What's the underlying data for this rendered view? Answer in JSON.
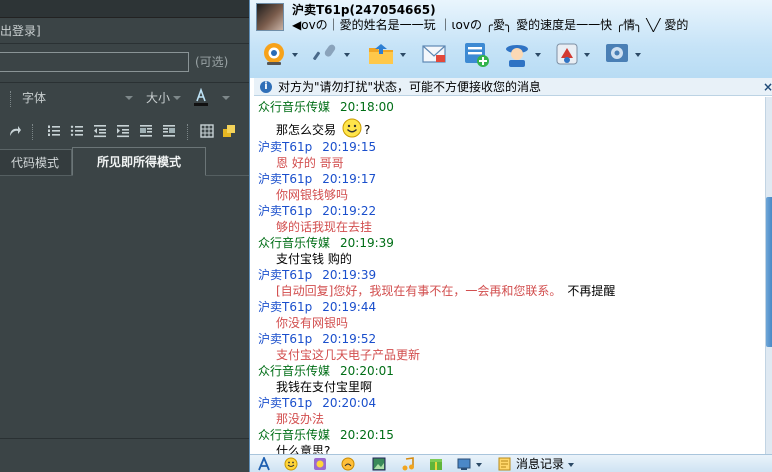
{
  "editor": {
    "logout_text": "出登录]",
    "optional_label": "(可选)",
    "toolbar": {
      "font_label": "字体",
      "size_label": "大小"
    },
    "tabs": [
      {
        "label": "代码模式"
      },
      {
        "label": "所见即所得模式"
      }
    ]
  },
  "chat": {
    "contact_name": "沪卖T61p(247054665)",
    "signature": "◀ovの｜愛的姓名是一一玩  ｜ιovの  ╭愛╮  愛的速度是一一快  ╭情╮  ╲╱  愛的",
    "notice": "对方为\"请勿打扰\"状态，可能不方便接收您的消息",
    "notice_close": "×",
    "messages": [
      {
        "sender": "众行音乐传媒",
        "time": "20:18:00",
        "text": "那怎么交易",
        "role": "self"
      },
      {
        "sender": "沪卖T61p",
        "time": "20:19:15",
        "text": "恩 好的 哥哥",
        "role": "peer"
      },
      {
        "sender": "沪卖T61p",
        "time": "20:19:17",
        "text": "你网银钱够吗",
        "role": "peer"
      },
      {
        "sender": "沪卖T61p",
        "time": "20:19:22",
        "text": "够的话我现在去挂",
        "role": "peer"
      },
      {
        "sender": "众行音乐传媒",
        "time": "20:19:39",
        "text": "支付宝钱  购的",
        "role": "self"
      },
      {
        "sender": "沪卖T61p",
        "time": "20:19:39",
        "text": "[自动回复]您好，我现在有事不在，一会再和您联系。",
        "extra": "不再提醒",
        "role": "peer"
      },
      {
        "sender": "沪卖T61p",
        "time": "20:19:44",
        "text": "你没有网银吗",
        "role": "peer"
      },
      {
        "sender": "沪卖T61p",
        "time": "20:19:52",
        "text": "支付宝这几天电子产品更新",
        "role": "peer"
      },
      {
        "sender": "众行音乐传媒",
        "time": "20:20:01",
        "text": "我钱在支付宝里啊",
        "role": "self"
      },
      {
        "sender": "沪卖T61p",
        "time": "20:20:04",
        "text": "那没办法",
        "role": "peer"
      },
      {
        "sender": "众行音乐传媒",
        "time": "20:20:15",
        "text": "什么意思?",
        "role": "self"
      }
    ],
    "first_msg_suffix": "?",
    "history_label": "消息记录"
  }
}
